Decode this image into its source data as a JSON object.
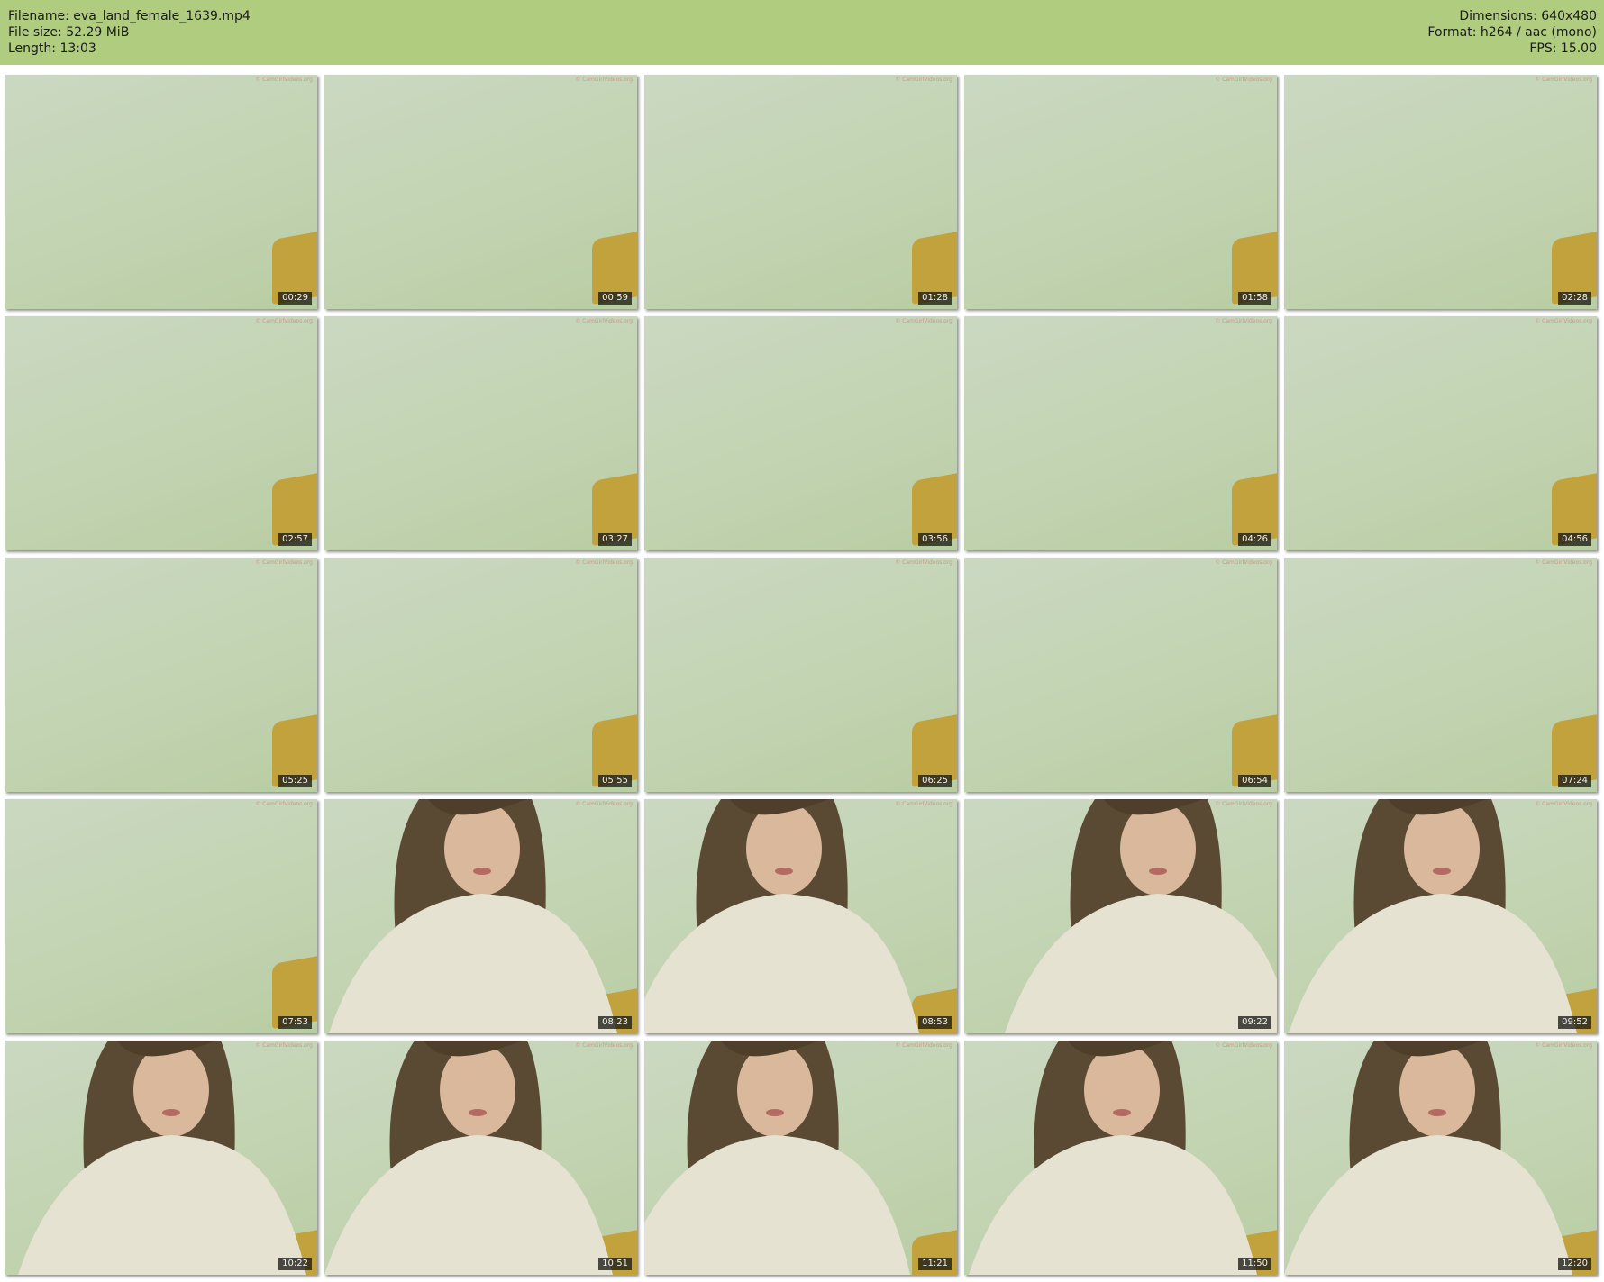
{
  "header": {
    "filename": "Filename: eva_land_female_1639.mp4",
    "filesize": "File size: 52.29 MiB",
    "length": "Length: 13:03",
    "dimensions": "Dimensions: 640x480",
    "format": "Format: h264 / aac (mono)",
    "fps": "FPS: 15.00"
  },
  "thumbnails": [
    {
      "time": "00:29",
      "scene": "wall"
    },
    {
      "time": "00:59",
      "scene": "wall"
    },
    {
      "time": "01:28",
      "scene": "wall"
    },
    {
      "time": "01:58",
      "scene": "wall"
    },
    {
      "time": "02:28",
      "scene": "wall"
    },
    {
      "time": "02:57",
      "scene": "wall"
    },
    {
      "time": "03:27",
      "scene": "wall"
    },
    {
      "time": "03:56",
      "scene": "wall"
    },
    {
      "time": "04:26",
      "scene": "wall"
    },
    {
      "time": "04:56",
      "scene": "wall"
    },
    {
      "time": "05:25",
      "scene": "wall"
    },
    {
      "time": "05:55",
      "scene": "wall"
    },
    {
      "time": "06:25",
      "scene": "wall"
    },
    {
      "time": "06:54",
      "scene": "wall"
    },
    {
      "time": "07:24",
      "scene": "wall"
    },
    {
      "time": "07:53",
      "scene": "wall"
    },
    {
      "time": "08:23",
      "scene": "person"
    },
    {
      "time": "08:53",
      "scene": "person"
    },
    {
      "time": "09:22",
      "scene": "person"
    },
    {
      "time": "09:52",
      "scene": "person"
    },
    {
      "time": "10:22",
      "scene": "person"
    },
    {
      "time": "10:51",
      "scene": "person"
    },
    {
      "time": "11:21",
      "scene": "person"
    },
    {
      "time": "11:50",
      "scene": "person"
    },
    {
      "time": "12:20",
      "scene": "person"
    }
  ],
  "watermark": "© CamGirlVideos.org",
  "colors": {
    "header": "#b0cd7f",
    "wall": "#c4d5b5",
    "cushion": "#c2a23d"
  }
}
